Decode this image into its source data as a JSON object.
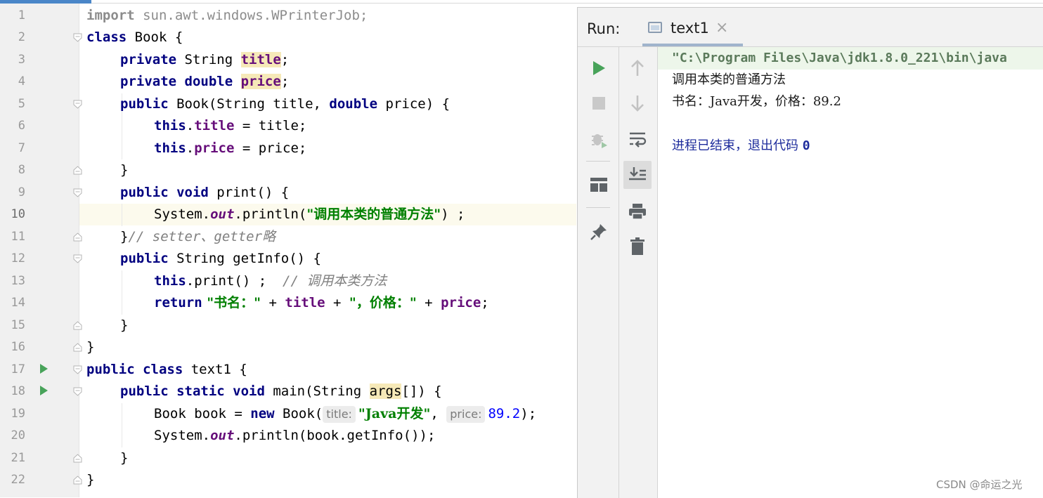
{
  "editor": {
    "line_numbers": [
      "1",
      "2",
      "3",
      "4",
      "5",
      "6",
      "7",
      "8",
      "9",
      "10",
      "11",
      "12",
      "13",
      "14",
      "15",
      "16",
      "17",
      "18",
      "19",
      "20",
      "21",
      "22"
    ],
    "l1_kw": "import",
    "l1_rest": " sun.awt.windows.WPrinterJob;",
    "l2_kw": "class",
    "l2_rest": " Book {",
    "l3_kw": "private",
    "l3_type": " String ",
    "l3_field": "title",
    "l3_end": ";",
    "l4_kw": "private double",
    "l4_sp": " ",
    "l4_field": "price",
    "l4_end": ";",
    "l5_kw1": "public",
    "l5_mid": " Book(String title, ",
    "l5_kw2": "double",
    "l5_end": " price) {",
    "l6_kw": "this",
    "l6_dot": ".",
    "l6_field": "title",
    "l6_end": " = title;",
    "l7_kw": "this",
    "l7_dot": ".",
    "l7_field": "price",
    "l7_end": " = price;",
    "l8": "}",
    "l9_kw": "public void",
    "l9_end": " print() {",
    "l10_a": "System.",
    "l10_out": "out",
    "l10_b": ".println(",
    "l10_str": "\"调用本类的普通方法\"",
    "l10_c": ") ;",
    "l11_a": "}",
    "l11_cmt": "// setter、getter略",
    "l12_kw": "public",
    "l12_end": " String getInfo() {",
    "l13_kw": "this",
    "l13_mid": ".print() ;  ",
    "l13_cmt": "// 调用本类方法",
    "l14_kw": "return",
    "l14_str1": " \"书名：\"",
    "l14_p1": " + ",
    "l14_f1": "title",
    "l14_p2": " + ",
    "l14_str2": "\"，价格：\"",
    "l14_p3": " + ",
    "l14_f2": "price",
    "l14_end": ";",
    "l15": "}",
    "l16": "}",
    "l17_kw": "public class",
    "l17_end": " text1 {",
    "l18_kw": "public static void",
    "l18_mid": " main(String ",
    "l18_args": "args",
    "l18_end": "[]) {",
    "l19_a": "Book book = ",
    "l19_kw": "new",
    "l19_b": " Book(",
    "l19_hint1": "title:",
    "l19_str": "\"Java开发\"",
    "l19_c": ", ",
    "l19_hint2": "price:",
    "l19_num": "89.2",
    "l19_end": ");",
    "l20_a": "System.",
    "l20_out": "out",
    "l20_b": ".println(book.getInfo());",
    "l21": "}",
    "l22": "}"
  },
  "run_panel": {
    "title": "Run:",
    "tab_label": "text1",
    "tab_close": "×"
  },
  "console": {
    "command": "\"C:\\Program Files\\Java\\jdk1.8.0_221\\bin\\java",
    "output_line1": "调用本类的普通方法",
    "output_line2": "书名：Java开发，价格：89.2",
    "exit_text": "进程已结束，退出代码 ",
    "exit_code": "0"
  },
  "colors": {
    "keyword": "#000080",
    "string": "#008000",
    "field": "#660e7a",
    "number": "#0000ff",
    "comment": "#808080",
    "run_green": "#48a35a",
    "current_line": "#fcfaed"
  },
  "icons": [
    "run-icon",
    "stop-icon",
    "debug-icon",
    "layout-icon",
    "pin-icon",
    "up-arrow-icon",
    "down-arrow-icon",
    "soft-wrap-icon",
    "scroll-to-end-icon",
    "print-icon",
    "trash-icon",
    "close-icon",
    "fold-icon"
  ],
  "watermark": "CSDN @命运之光"
}
